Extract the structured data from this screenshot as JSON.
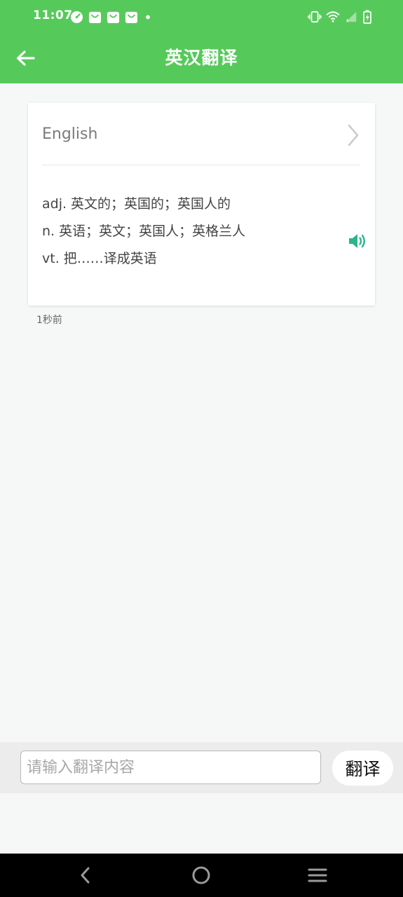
{
  "status_bar": {
    "time": "11:07",
    "left_icons": [
      "speedometer-icon",
      "shopping-bag-icon",
      "shopping-bag-icon",
      "shopping-bag-icon",
      "dot-icon"
    ],
    "right_icons": [
      "vibrate-icon",
      "wifi-icon",
      "signal-icon",
      "battery-charging-icon"
    ],
    "color": "#56c95b"
  },
  "header": {
    "title": "英汉翻译",
    "back_icon": "arrow-left-icon"
  },
  "result": {
    "word": "English",
    "definitions": [
      "adj. 英文的；英国的；英国人的",
      "n. 英语；英文；英国人；英格兰人",
      "vt. 把……译成英语"
    ],
    "speaker_icon": "speaker-icon",
    "speaker_color": "#2bb58c",
    "detail_icon": "chevron-right-icon",
    "timestamp": "1秒前"
  },
  "input_bar": {
    "placeholder": "请输入翻译内容",
    "value": "",
    "button_label": "翻译"
  },
  "nav_bar": {
    "icons": [
      "back-triangle-icon",
      "home-circle-icon",
      "menu-lines-icon"
    ]
  }
}
